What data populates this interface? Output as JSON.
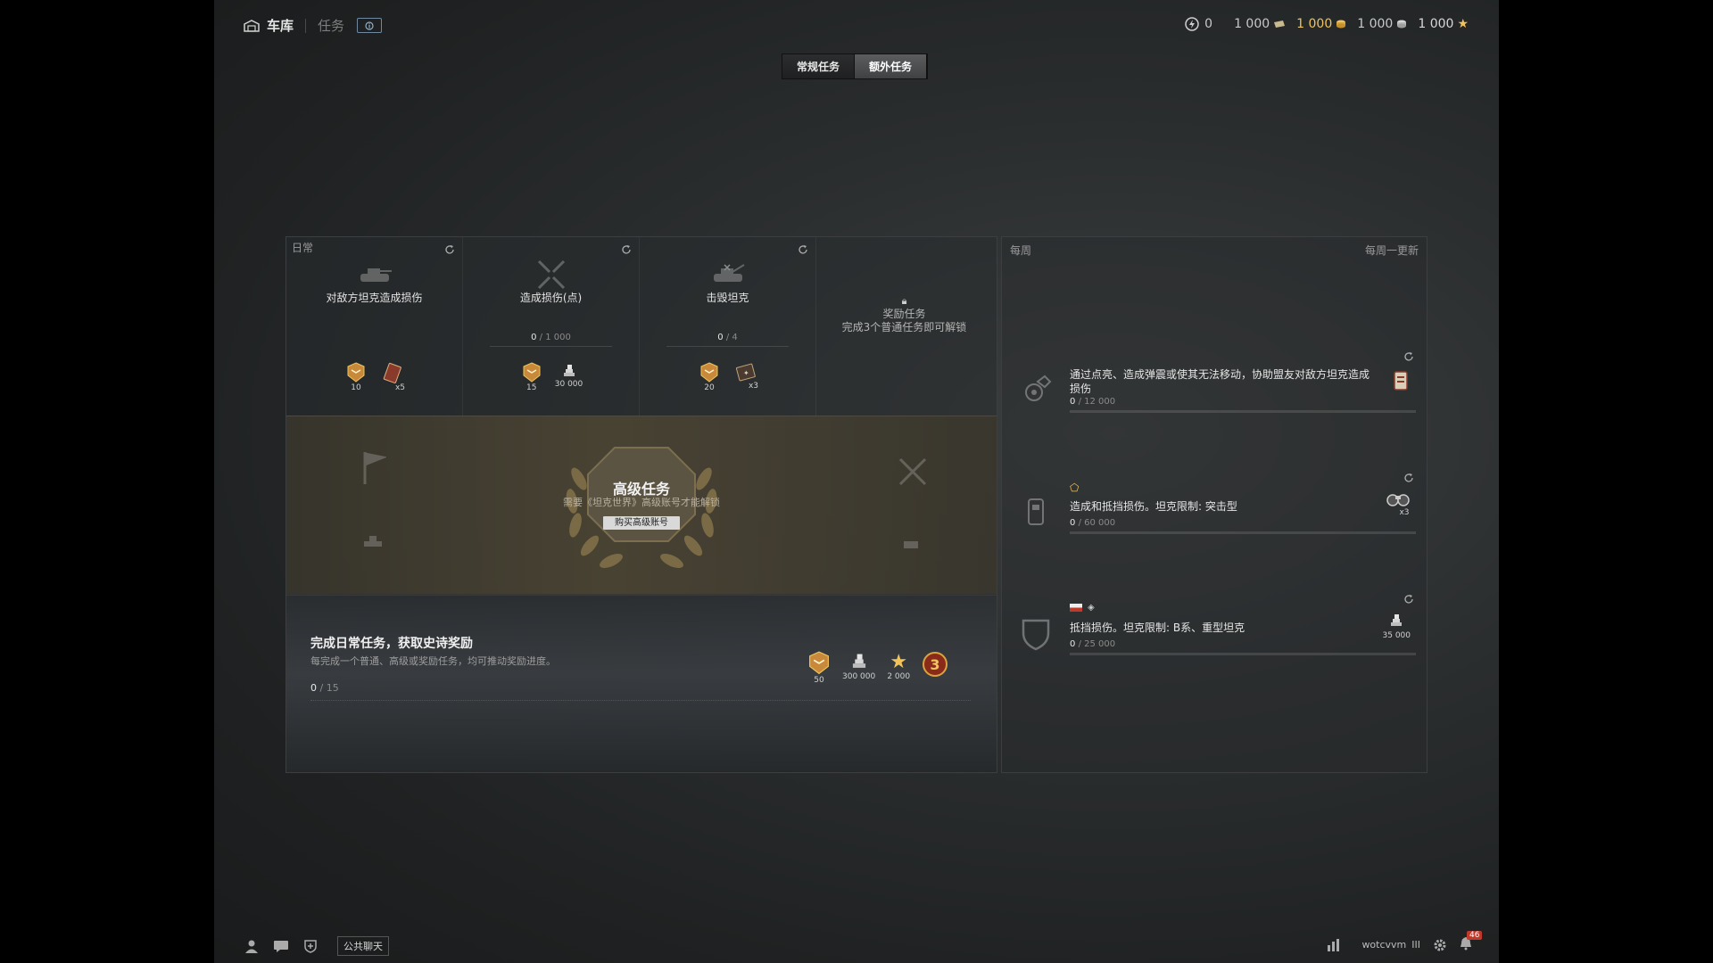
{
  "topbar": {
    "garage_label": "车库",
    "missions_label": "任务",
    "currencies": [
      {
        "name": "blueprints",
        "value": "0",
        "icon": "lightning-icon"
      },
      {
        "name": "bonds",
        "value": "1 000",
        "icon": "bond-icon"
      },
      {
        "name": "gold",
        "value": "1 000",
        "icon": "gold-icon",
        "color": "#f0c35b"
      },
      {
        "name": "credits",
        "value": "1 000",
        "icon": "credits-icon"
      },
      {
        "name": "free_xp",
        "value": "1 000",
        "icon": "star-icon"
      }
    ]
  },
  "tabs": [
    {
      "label": "常规任务",
      "active": false
    },
    {
      "label": "额外任务",
      "active": true
    }
  ],
  "daily": {
    "label": "日常",
    "quests": [
      {
        "title": "对敌方坦克造成损伤",
        "icon": "tank-icon",
        "progress": "",
        "total": "",
        "rewards": [
          {
            "icon": "medal-icon",
            "count": "10"
          },
          {
            "icon": "card-icon",
            "count": "x5"
          }
        ]
      },
      {
        "title": "造成损伤(点)",
        "icon": "crossed-shells-icon",
        "progress": "0",
        "total": "1 000",
        "rewards": [
          {
            "icon": "medal-icon",
            "count": "15"
          },
          {
            "icon": "credits-icon",
            "count": "30 000"
          }
        ]
      },
      {
        "title": "击毁坦克",
        "icon": "destroyed-tank-icon",
        "progress": "0",
        "total": "4",
        "rewards": [
          {
            "icon": "medal-icon",
            "count": "20"
          },
          {
            "icon": "book-icon",
            "count": "x3"
          }
        ]
      }
    ],
    "locked": {
      "title": "奖励任务",
      "subtitle": "完成3个普通任务即可解锁"
    },
    "premium": {
      "title": "高级任务",
      "subtitle": "需要《坦克世界》高级账号才能解锁",
      "button": "购买高级账号"
    },
    "epic": {
      "title": "完成日常任务，获取史诗奖励",
      "subtitle": "每完成一个普通、高级或奖励任务，均可推动奖励进度。",
      "progress": "0",
      "total": "15",
      "rewards": [
        {
          "icon": "medal-icon",
          "count": "50"
        },
        {
          "icon": "credits-icon",
          "count": "300 000"
        },
        {
          "icon": "star-icon",
          "count": "2 000"
        },
        {
          "icon": "badge-3-icon",
          "count": "3"
        }
      ]
    }
  },
  "weekly": {
    "label": "每周",
    "update_label": "每周一更新",
    "quests": [
      {
        "title": "通过点亮、造成弹震或使其无法移动，协助盟友对敌方坦克造成损伤",
        "progress": "0",
        "total": "12 000",
        "icon": "assist-icon",
        "reward": {
          "icon": "scroll-icon",
          "count": ""
        }
      },
      {
        "title": "造成和抵挡损伤。坦克限制: 突击型",
        "progress": "0",
        "total": "60 000",
        "icon": "phone-icon",
        "reward": {
          "icon": "binoculars-icon",
          "count": "x3"
        }
      },
      {
        "title": "抵挡损伤。坦克限制: B系、重型坦克",
        "progress": "0",
        "total": "25 000",
        "icon": "shield-icon",
        "reward": {
          "icon": "credits-icon",
          "count": "35 000"
        }
      }
    ]
  },
  "bottombar": {
    "chat_label": "公共聊天",
    "username": "wotcvvm",
    "notifications": "46"
  },
  "colors": {
    "gold": "#f0c35b",
    "bronze": "#c88a3a"
  }
}
